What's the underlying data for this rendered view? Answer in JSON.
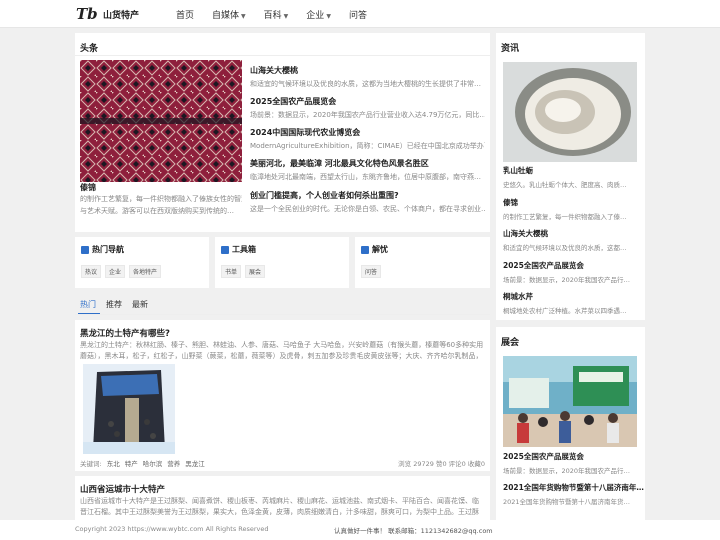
{
  "header": {
    "logo_mark": "Tb",
    "site_name": "山货特产",
    "nav": [
      {
        "label": "首页",
        "caret": ""
      },
      {
        "label": "自媒体",
        "caret": "▼"
      },
      {
        "label": "百科",
        "caret": "▼"
      },
      {
        "label": "企业",
        "caret": "▼"
      },
      {
        "label": "问答",
        "caret": ""
      }
    ]
  },
  "headlines": {
    "title": "头条",
    "feature": {
      "title": "傣锦",
      "desc": "的制作工艺繁复，每一件织物都融入了傣族女性的智慧与艺术天赋。游客可以在西双版纳购买到传统的…"
    },
    "items": [
      {
        "title": "山海关大樱桃",
        "desc": "和适宜的气候环境以及优良的水质，这都为当地大樱桃的生长提供了非常…"
      },
      {
        "title": "2025全国农产品展览会",
        "desc": "场前景：数据显示，2020年我国农产品行业营业收入达4.79万亿元，同比…"
      },
      {
        "title": "2024中国国际现代农业博览会",
        "desc": "ModernAgricultureExhibition，简称：CIMAE）已经在中国北京成功举办了…"
      },
      {
        "title": "美丽河北，最美临漳 河北最具文化特色风景名胜区",
        "desc": "临漳地处河北最南端，西望太行山，东眺齐鲁地，位居中原腹部，南守燕…"
      },
      {
        "title": "创业门槛提高，个人创业者如何杀出重围?",
        "desc": "这是一个全民创业的时代。无论你是白领、农民、个体商户，都在寻求创业…"
      }
    ]
  },
  "widgets": [
    {
      "title": "热门导航",
      "icon": "grid-icon",
      "tags": [
        "热议",
        "企业",
        "各地特产"
      ]
    },
    {
      "title": "工具箱",
      "icon": "toolbox-icon",
      "tags": [
        "书单",
        "展会"
      ]
    },
    {
      "title": "解忧",
      "icon": "help-icon",
      "tags": [
        "问答"
      ]
    }
  ],
  "tabs": [
    "热门",
    "推荐",
    "最新"
  ],
  "articles": [
    {
      "title": "黑龙江的土特产有哪些?",
      "desc": "黑龙江的土特产：秋林红肠、榛子、熊胆、林蛙油、人参、唐菇、马哈鱼子 大马哈鱼，兴安岭蘑菇（有猴头蘑，榛蘑等60多种实用蘑菇），黑木耳，松子，红松子，山野菜（蕨菜，松蘑，薇菜等）及虎骨，刺五加参及珍贵毛皮黄皮张等；大庆、齐齐哈尔乳制品，哈尔…",
      "keywords_label": "关键词:",
      "keywords": [
        "东北",
        "特产",
        "哈尔滨",
        "营养",
        "黑龙江"
      ],
      "stats": "浏览 29729 赞0 评论0 收藏0"
    },
    {
      "title": "山西省运城市十大特产",
      "desc": "山西省运城市十大特产是王过酥梨、闻喜煮饼、稷山板枣、芮城麻片、稷山麻花、运城池盐、南式烟卡、平陆百合、闻喜花馍、临晋江石榴。其中王过酥梨美誉为王过酥梨，果实大，色泽金黄，皮薄，肉质细嫩清白，汁多味甜，酥爽可口，为梨中上品。王过酥梨：王过酥梨，…"
    }
  ],
  "sidebar": {
    "news_title": "资讯",
    "news_feature": {
      "title": "乳山牡蛎",
      "desc": "史悠久。乳山牡蛎个体大、肥度高、肉质…"
    },
    "news_items": [
      {
        "title": "傣锦",
        "desc": "的制作工艺繁复，每一件织物都融入了傣…"
      },
      {
        "title": "山海关大樱桃",
        "desc": "和适宜的气候环境以及优良的水质，这都…"
      },
      {
        "title": "2025全国农产品展览会",
        "desc": "场前景：数据显示，2020年我国农产品行…"
      },
      {
        "title": "桐城水芹",
        "desc": "桐城地处农村广泛种植。水芹菜以四季遇…"
      }
    ],
    "expo_title": "展会",
    "expo_items": [
      {
        "title": "2025全国农产品展览会",
        "desc": "场前景：数据显示，2020年我国农产品行…"
      },
      {
        "title": "2021全国年货购物节暨第十八届济南年…",
        "desc": "2021全国年货购物节暨第十八届济南年货…"
      }
    ]
  },
  "footer": {
    "copyright": "Copyright 2023 https://www.wybtc.com All Rights Reserved",
    "contact_prefix": "认真做好一件事！ 联系邮箱：",
    "contact_email": "1121342682@qq.com"
  }
}
